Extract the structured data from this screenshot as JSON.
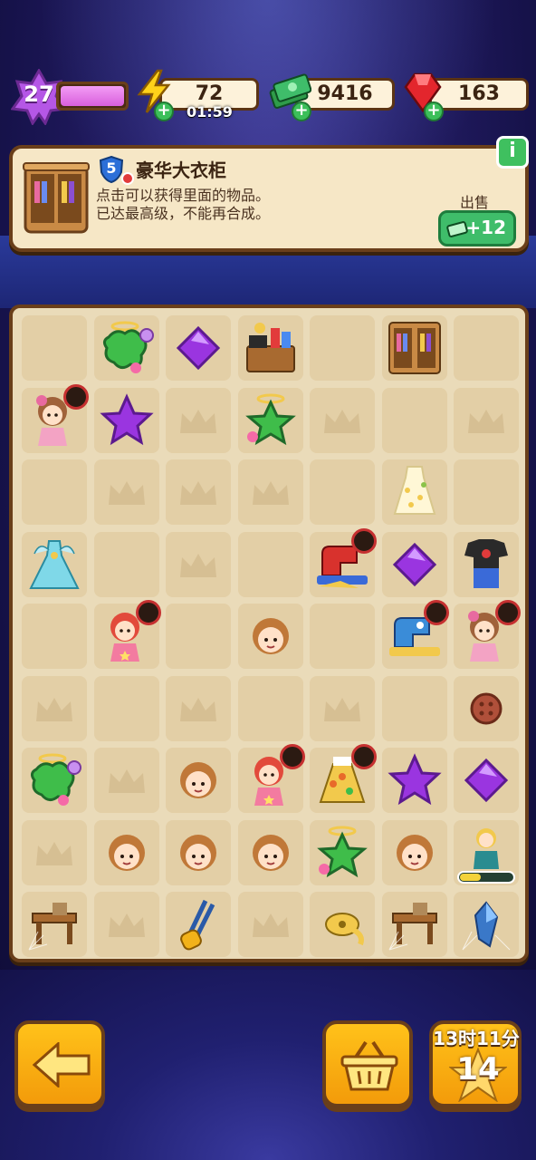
{
  "top_bar": {
    "level": "27",
    "energy": "72",
    "energy_timer": "01:59",
    "cash": "9416",
    "gems": "163"
  },
  "info_panel": {
    "item_level": "5",
    "item_name": "豪华大衣柜",
    "desc_line1": "点击可以获得里面的物品。",
    "desc_line2": "已达最高级，不能再合成。",
    "sell_label": "出售",
    "sell_value": "+12",
    "info_button": "i"
  },
  "board": {
    "rows": 9,
    "cols": 7,
    "items": [
      [
        "empty",
        "star-cookie-halo",
        "purple-gem",
        "sewing-desk",
        "empty",
        "wardrobe",
        "empty"
      ],
      [
        "girl-locked",
        "purple-star",
        "crown",
        "star-halo",
        "crown",
        "empty",
        "crown"
      ],
      [
        "empty",
        "crown",
        "crown",
        "crown",
        "empty",
        "dress-yellow",
        "empty"
      ],
      [
        "dress-gown",
        "empty",
        "crown",
        "empty",
        "sewing-machine-locked",
        "purple-gem",
        "shirt-jeans"
      ],
      [
        "empty",
        "girl-red-locked",
        "empty",
        "doll-head",
        "empty",
        "sewing-machine-blue-locked",
        "girl-locked"
      ],
      [
        "crown",
        "empty",
        "crown",
        "empty",
        "crown",
        "empty",
        "button"
      ],
      [
        "star-cookie-halo",
        "crown",
        "doll-head",
        "girl-red-locked",
        "skirt-locked",
        "purple-star",
        "purple-gem"
      ],
      [
        "crown",
        "doll-head",
        "doll-head",
        "doll-head",
        "star-halo",
        "doll-head",
        "worker-progress"
      ],
      [
        "desk-cobweb",
        "crown",
        "scissors",
        "crown",
        "measuring-tape",
        "desk-cobweb",
        "crystal-cobweb"
      ]
    ],
    "worker_progress": 0.4
  },
  "bottom": {
    "clock": "13时11分",
    "box_count": "14"
  },
  "colors": {
    "panel_bg": "#f6e7c6",
    "panel_border": "#6a3f1a",
    "green_button": "#3fbd6a",
    "orange_button": "#f7ad10",
    "purple_gem": "#9a35e0"
  }
}
